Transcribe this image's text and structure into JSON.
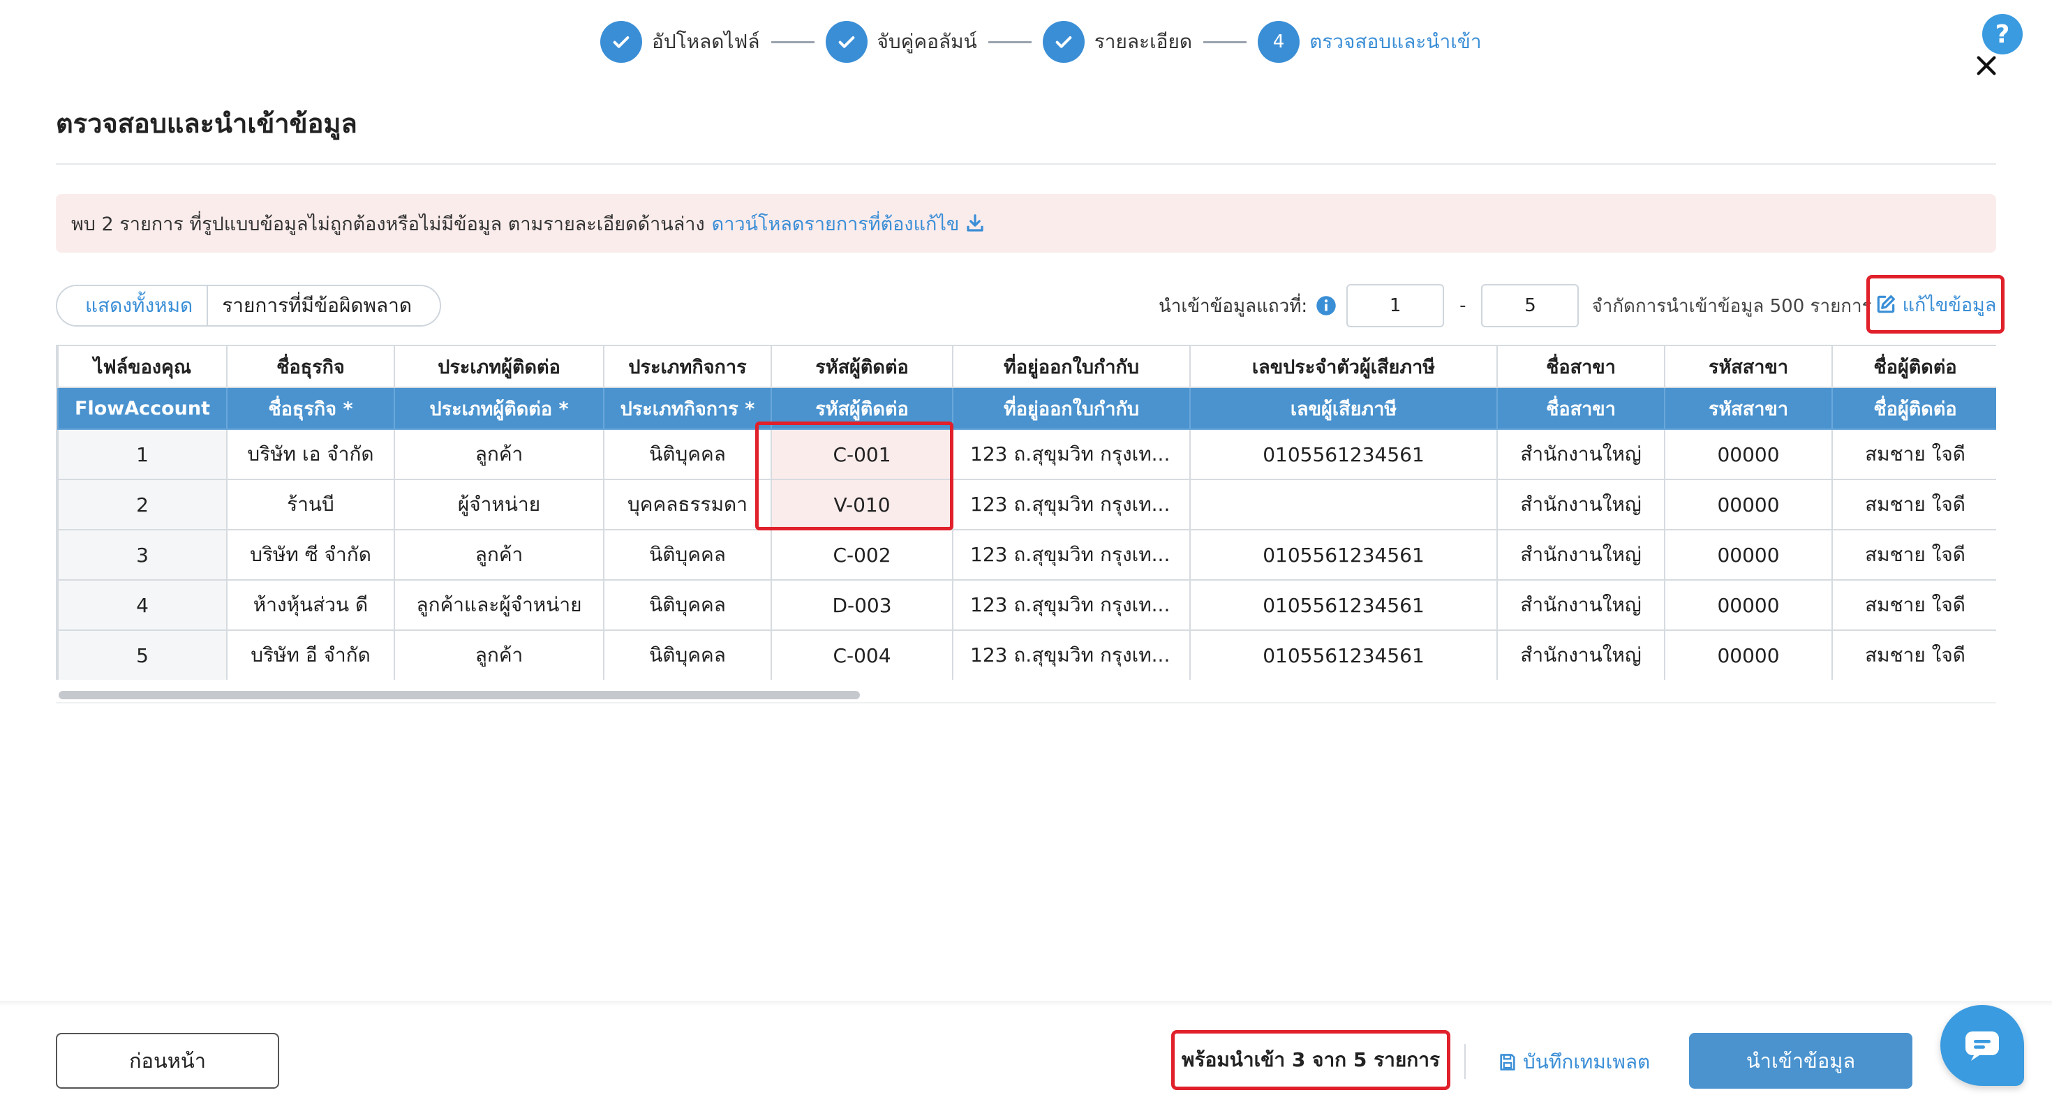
{
  "stepper": {
    "steps": [
      {
        "label": "อัปโหลดไฟล์",
        "state": "done"
      },
      {
        "label": "จับคู่คอลัมน์",
        "state": "done"
      },
      {
        "label": "รายละเอียด",
        "state": "done"
      },
      {
        "label": "ตรวจสอบและนำเข้า",
        "state": "active",
        "number": "4"
      }
    ]
  },
  "help": {
    "label": "?"
  },
  "page": {
    "title": "ตรวจสอบและนำเข้าข้อมูล"
  },
  "alert": {
    "message": "พบ 2 รายการ ที่รูปแบบข้อมูลไม่ถูกต้องหรือไม่มีข้อมูล ตามรายละเอียดด้านล่าง",
    "link": "ดาวน์โหลดรายการที่ต้องแก้ไข"
  },
  "filters": {
    "all": "แสดงทั้งหมด",
    "errors": "รายการที่มีข้อผิดพลาด"
  },
  "range": {
    "label": "นำเข้าข้อมูลแถวที่:",
    "from": "1",
    "separator": "-",
    "to": "5",
    "limit": "จำกัดการนำเข้าข้อมูล 500 รายการ"
  },
  "edit": {
    "label": "แก้ไขข้อมูล"
  },
  "table": {
    "file_headers": [
      "ไฟล์ของคุณ",
      "ชื่อธุรกิจ",
      "ประเภทผู้ติดต่อ",
      "ประเภทกิจการ",
      "รหัสผู้ติดต่อ",
      "ที่อยู่ออกใบกำกับ",
      "เลขประจำตัวผู้เสียภาษี",
      "ชื่อสาขา",
      "รหัสสาขา",
      "ชื่อผู้ติดต่อ"
    ],
    "fa_headers": [
      "FlowAccount",
      "ชื่อธุรกิจ *",
      "ประเภทผู้ติดต่อ *",
      "ประเภทกิจการ *",
      "รหัสผู้ติดต่อ",
      "ที่อยู่ออกใบกำกับ",
      "เลขผู้เสียภาษี",
      "ชื่อสาขา",
      "รหัสสาขา",
      "ชื่อผู้ติดต่อ"
    ],
    "rows": [
      [
        "1",
        "บริษัท เอ จำกัด",
        "ลูกค้า",
        "นิติบุคคล",
        "C-001",
        "123 ถ.สุขุมวิท กรุงเท...",
        "0105561234561",
        "สำนักงานใหญ่",
        "00000",
        "สมชาย ใจดี"
      ],
      [
        "2",
        "ร้านบี",
        "ผู้จำหน่าย",
        "บุคคลธรรมดา",
        "V-010",
        "123 ถ.สุขุมวิท กรุงเท...",
        "",
        "สำนักงานใหญ่",
        "00000",
        "สมชาย ใจดี"
      ],
      [
        "3",
        "บริษัท ซี จำกัด",
        "ลูกค้า",
        "นิติบุคคล",
        "C-002",
        "123 ถ.สุขุมวิท กรุงเท...",
        "0105561234561",
        "สำนักงานใหญ่",
        "00000",
        "สมชาย ใจดี"
      ],
      [
        "4",
        "ห้างหุ้นส่วน ดี",
        "ลูกค้าและผู้จำหน่าย",
        "นิติบุคคล",
        "D-003",
        "123 ถ.สุขุมวิท กรุงเท...",
        "0105561234561",
        "สำนักงานใหญ่",
        "00000",
        "สมชาย ใจดี"
      ],
      [
        "5",
        "บริษัท อี จำกัด",
        "ลูกค้า",
        "นิติบุคคล",
        "C-004",
        "123 ถ.สุขุมวิท กรุงเท...",
        "0105561234561",
        "สำนักงานใหญ่",
        "00000",
        "สมชาย ใจดี"
      ]
    ]
  },
  "footer": {
    "back": "ก่อนหน้า",
    "ready": "พร้อมนำเข้า 3 จาก 5 รายการ",
    "save_template": "บันทึกเทมเพลต",
    "import": "นำเข้าข้อมูล"
  },
  "colors": {
    "primary": "#3a8ed6",
    "header_bg": "#4a93cf",
    "error_bg": "#fbecec",
    "highlight": "#e0202a"
  },
  "icons": [
    "check-icon",
    "help-icon",
    "close-icon",
    "download-icon",
    "info-icon",
    "edit-icon",
    "save-icon",
    "chat-icon"
  ]
}
